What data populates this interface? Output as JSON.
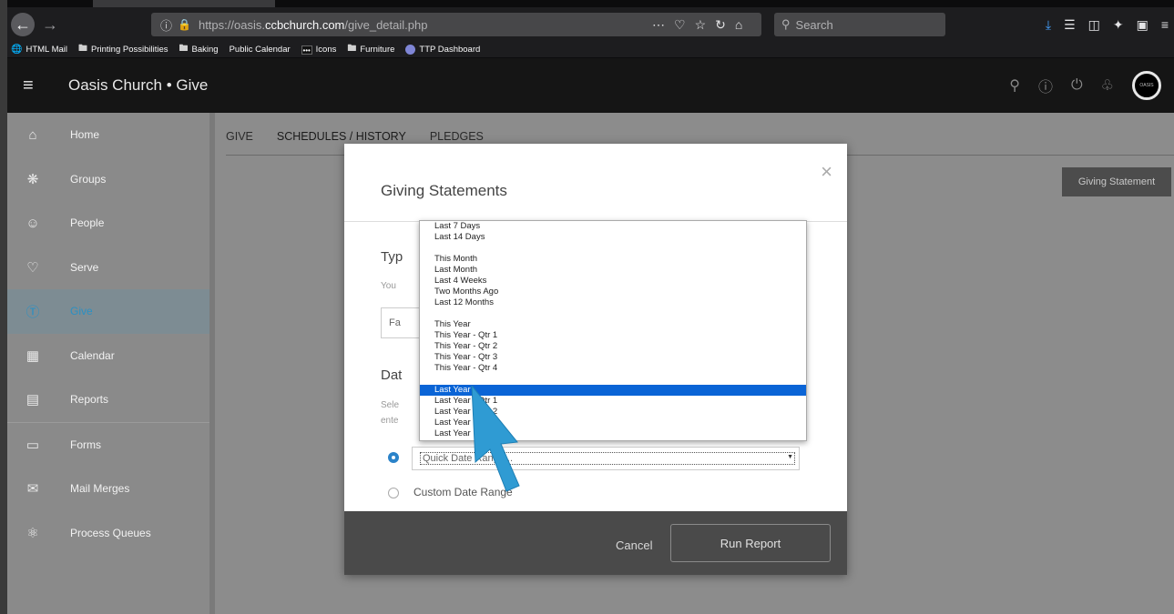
{
  "browser": {
    "url_prefix": "https://oasis.",
    "url_host": "ccbchurch.com",
    "url_path": "/give_detail.php",
    "url_icons": [
      "···",
      "☆",
      "☆"
    ],
    "search_placeholder": "Search",
    "bookmarks": [
      {
        "label": "HTML Mail",
        "icon": "globe-icon"
      },
      {
        "label": "Printing Possibilities",
        "icon": "folder-icon"
      },
      {
        "label": "Baking",
        "icon": "folder-icon"
      },
      {
        "label": "Public Calendar",
        "icon": "none"
      },
      {
        "label": "Icons",
        "icon": "dots-icon"
      },
      {
        "label": "Furniture",
        "icon": "folder-icon"
      },
      {
        "label": "TTP Dashboard",
        "icon": "ttp-icon"
      }
    ]
  },
  "app": {
    "title": "Oasis Church • Give",
    "avatar_text": "OASIS"
  },
  "sidebar": {
    "items": [
      {
        "label": "Home",
        "icon": "home-icon"
      },
      {
        "label": "Groups",
        "icon": "groups-icon"
      },
      {
        "label": "People",
        "icon": "people-icon"
      },
      {
        "label": "Serve",
        "icon": "heart-icon"
      },
      {
        "label": "Give",
        "icon": "dollar-icon",
        "active": true
      },
      {
        "label": "Calendar",
        "icon": "calendar-icon"
      },
      {
        "label": "Reports",
        "icon": "reports-icon"
      },
      {
        "label": "Forms",
        "icon": "forms-icon"
      },
      {
        "label": "Mail Merges",
        "icon": "mail-icon"
      },
      {
        "label": "Process Queues",
        "icon": "process-icon"
      }
    ]
  },
  "main": {
    "tabs": [
      "GIVE",
      "SCHEDULES / HISTORY",
      "PLEDGES"
    ],
    "giving_statement_button": "Giving Statement"
  },
  "modal": {
    "title": "Giving Statements",
    "type_heading": "Typ",
    "type_help": "You",
    "type_value": "Fa",
    "date_heading": "Dat",
    "date_help_1": "Sele",
    "date_help_2": "ente",
    "quick_range_placeholder": "Quick Date Range...",
    "custom_range_label": "Custom Date Range",
    "cancel_label": "Cancel",
    "run_label": "Run Report"
  },
  "dropdown": {
    "groups": [
      [
        "Last 7 Days",
        "Last 14 Days"
      ],
      [
        "This Month",
        "Last Month",
        "Last 4 Weeks",
        "Two Months Ago",
        "Last 12 Months"
      ],
      [
        "This Year",
        "This Year - Qtr 1",
        "This Year - Qtr 2",
        "This Year - Qtr 3",
        "This Year - Qtr 4"
      ],
      [
        "Last Year",
        "Last Year - Qtr 1",
        "Last Year - Qtr 2",
        "Last Year",
        "Last Year"
      ]
    ],
    "selected": "Last Year"
  },
  "colors": {
    "accent": "#2b90c3",
    "selection": "#0a64d6",
    "cursor": "#2f9bd3"
  }
}
